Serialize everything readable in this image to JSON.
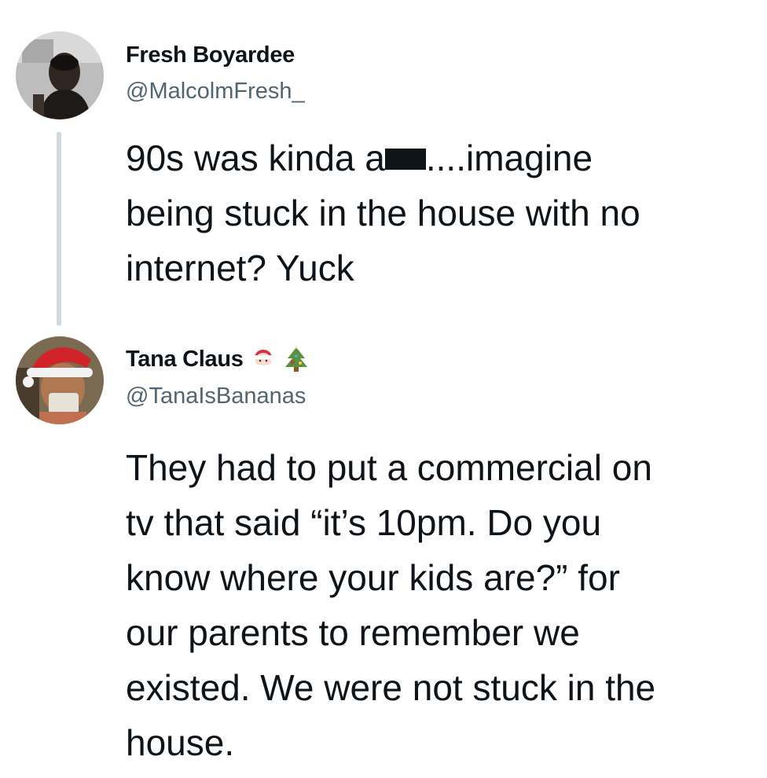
{
  "tweets": [
    {
      "display_name": "Fresh Boyardee",
      "handle": "@MalcolmFresh_",
      "text_before_redaction": "90s was kinda a",
      "text_after_redaction": "....imagine\nbeing stuck in the house with no\ninternet? Yuck",
      "avatar_icon": "man-selfie-avatar"
    },
    {
      "display_name": "Tana Claus",
      "name_emojis": [
        "santa-claus-icon",
        "christmas-tree-icon"
      ],
      "handle": "@TanaIsBananas",
      "text": "They had to put a commercial on\ntv that said “it’s 10pm. Do you\nknow where your kids are?” for\nour parents to remember we\nexisted. We were not stuck in the\nhouse.",
      "avatar_icon": "woman-santa-hat-avatar"
    }
  ],
  "colors": {
    "text": "#0f1419",
    "handle": "#536471",
    "thread_line": "#cfd9de"
  }
}
